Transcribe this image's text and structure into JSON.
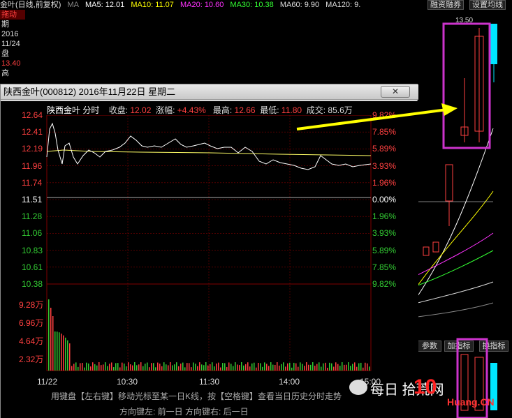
{
  "ma_bar": {
    "prefix": "金叶(日线,前复权)",
    "sep": "MA",
    "ma5": "MA5: 12.01",
    "ma10": "MA10: 11.07",
    "ma20": "MA20: 10.60",
    "ma30": "MA30: 10.38",
    "ma60": "MA60: 9.90",
    "ma120": "MA120: 9."
  },
  "colors": {
    "ma5": "#ffffff",
    "ma10": "#ffff00",
    "ma20": "#ff00ff",
    "ma30": "#00ff00",
    "ma60": "#cccccc",
    "ma120": "#aaaaaa",
    "up": "#ff4040",
    "down": "#33cc33",
    "flat": "#ffffff",
    "highlight": "#cc33cc",
    "arrow": "#ffff00"
  },
  "left_panel": {
    "drag_label": "拖动",
    "period_label": "期",
    "year": "2016",
    "date": "11/24",
    "pan_label": "盘",
    "price": "13.40",
    "high_label": "高"
  },
  "kline_header": {
    "btn1": "融资融券",
    "btn2": "设置均线",
    "top_price": "13.50",
    "params": "参数",
    "add_indicator": "加指标",
    "switch_indicator": "换指标"
  },
  "dialog": {
    "title": "陕西金叶(000812) 2016年11月22日 星期二",
    "close_glyph": "✕",
    "header": {
      "name": "陕西金叶 分时",
      "close_label": "收盘:",
      "close_value": "12.02",
      "change_label": "涨幅:",
      "change_value": "+4.43%",
      "high_label": "最高:",
      "high_value": "12.66",
      "low_label": "最低:",
      "low_value": "11.80",
      "vol_label": "成交:",
      "vol_value": "85.6万"
    },
    "price_axis": [
      "12.64",
      "12.41",
      "12.19",
      "11.96",
      "11.74",
      "11.51",
      "11.28",
      "11.06",
      "10.83",
      "10.61",
      "10.38"
    ],
    "pct_axis": [
      "9.82%",
      "7.85%",
      "5.89%",
      "3.93%",
      "1.96%",
      "0.00%",
      "1.96%",
      "3.93%",
      "5.89%",
      "7.85%",
      "9.82%"
    ],
    "vol_axis": [
      "9.28万",
      "6.96万",
      "4.64万",
      "2.32万"
    ],
    "time_axis": [
      "11/22",
      "10:30",
      "11:30",
      "14:00",
      "15:00"
    ],
    "hint1": "用键盘【左右键】移动光标至某一日K线，按【空格键】查看当日历史分时走势",
    "hint2": "方向键左: 前一日    方向键右: 后一日"
  },
  "watermark": "每日  拾荒网",
  "watermark_site": "Huang.CN",
  "watermark_num": "10"
}
